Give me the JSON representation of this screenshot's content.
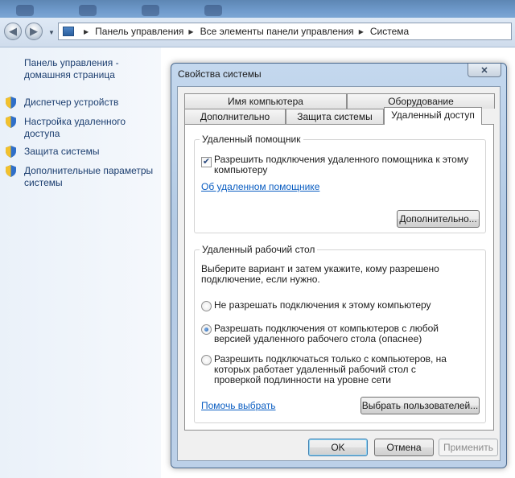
{
  "explorer": {
    "breadcrumbs": [
      "Панель управления",
      "Все элементы панели управления",
      "Система"
    ],
    "left_pane": {
      "home_link": "Панель управления - домашняя страница",
      "items": [
        {
          "label": "Диспетчер устройств",
          "icon": "shield-icon"
        },
        {
          "label": "Настройка удаленного доступа",
          "icon": "shield-icon"
        },
        {
          "label": "Защита системы",
          "icon": "shield-icon"
        },
        {
          "label": "Дополнительные параметры системы",
          "icon": "shield-icon"
        }
      ]
    }
  },
  "dialog": {
    "title": "Свойства системы",
    "close_label": "✕",
    "tabs_top": [
      "Имя компьютера",
      "Оборудование"
    ],
    "tabs_bottom": [
      "Дополнительно",
      "Защита системы",
      "Удаленный доступ"
    ],
    "active_tab": "Удаленный доступ",
    "remote_assistance": {
      "group_title": "Удаленный помощник",
      "checkbox_label": "Разрешить подключения удаленного помощника к этому компьютеру",
      "checkbox_checked": true,
      "link": "Об удаленном помощнике",
      "advanced_button": "Дополнительно..."
    },
    "remote_desktop": {
      "group_title": "Удаленный рабочий стол",
      "description": "Выберите вариант и затем укажите, кому разрешено подключение, если нужно.",
      "options": [
        {
          "label": "Не разрешать подключения к этому компьютеру",
          "checked": false
        },
        {
          "label": "Разрешать подключения от компьютеров с любой версией удаленного рабочего стола (опаснее)",
          "checked": true
        },
        {
          "label": "Разрешить подключаться только с компьютеров, на которых работает удаленный рабочий стол с проверкой подлинности на уровне сети",
          "checked": false
        }
      ],
      "help_link": "Помочь выбрать",
      "select_users_button": "Выбрать пользователей..."
    },
    "buttons": {
      "ok": "OK",
      "cancel": "Отмена",
      "apply": "Применить"
    }
  },
  "colors": {
    "link": "#0b5ec2",
    "nav_link": "#1d3f70",
    "dialog_frame": "#b3cae4"
  }
}
